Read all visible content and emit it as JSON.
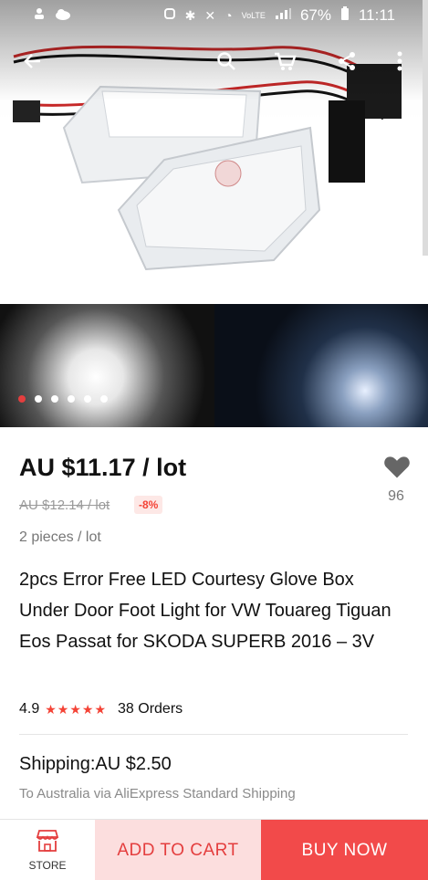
{
  "status_bar": {
    "battery": "67%",
    "time": "11:11"
  },
  "gallery": {
    "dot_count": 6,
    "active_dot": 0
  },
  "product": {
    "price": "AU $11.17 / lot",
    "original_price": "AU $12.14 / lot",
    "discount": "-8%",
    "wishlist_count": "96",
    "pieces": "2 pieces / lot",
    "title": "2pcs Error Free LED Courtesy Glove Box Under Door Foot Light for VW Touareg Tiguan Eos Passat for SKODA SUPERB 2016 – 3V",
    "rating": "4.9",
    "stars": "★★★★★",
    "orders": "38 Orders"
  },
  "shipping": {
    "label": "Shipping:AU $2.50",
    "detail": "To Australia via AliExpress Standard Shipping"
  },
  "bottom_bar": {
    "store_label": "STORE",
    "add_to_cart": "ADD TO CART",
    "buy_now": "BUY NOW"
  },
  "colors": {
    "accent": "#f44336",
    "buy_now_bg": "#f24a4a",
    "add_to_cart_bg": "#fcdede"
  }
}
